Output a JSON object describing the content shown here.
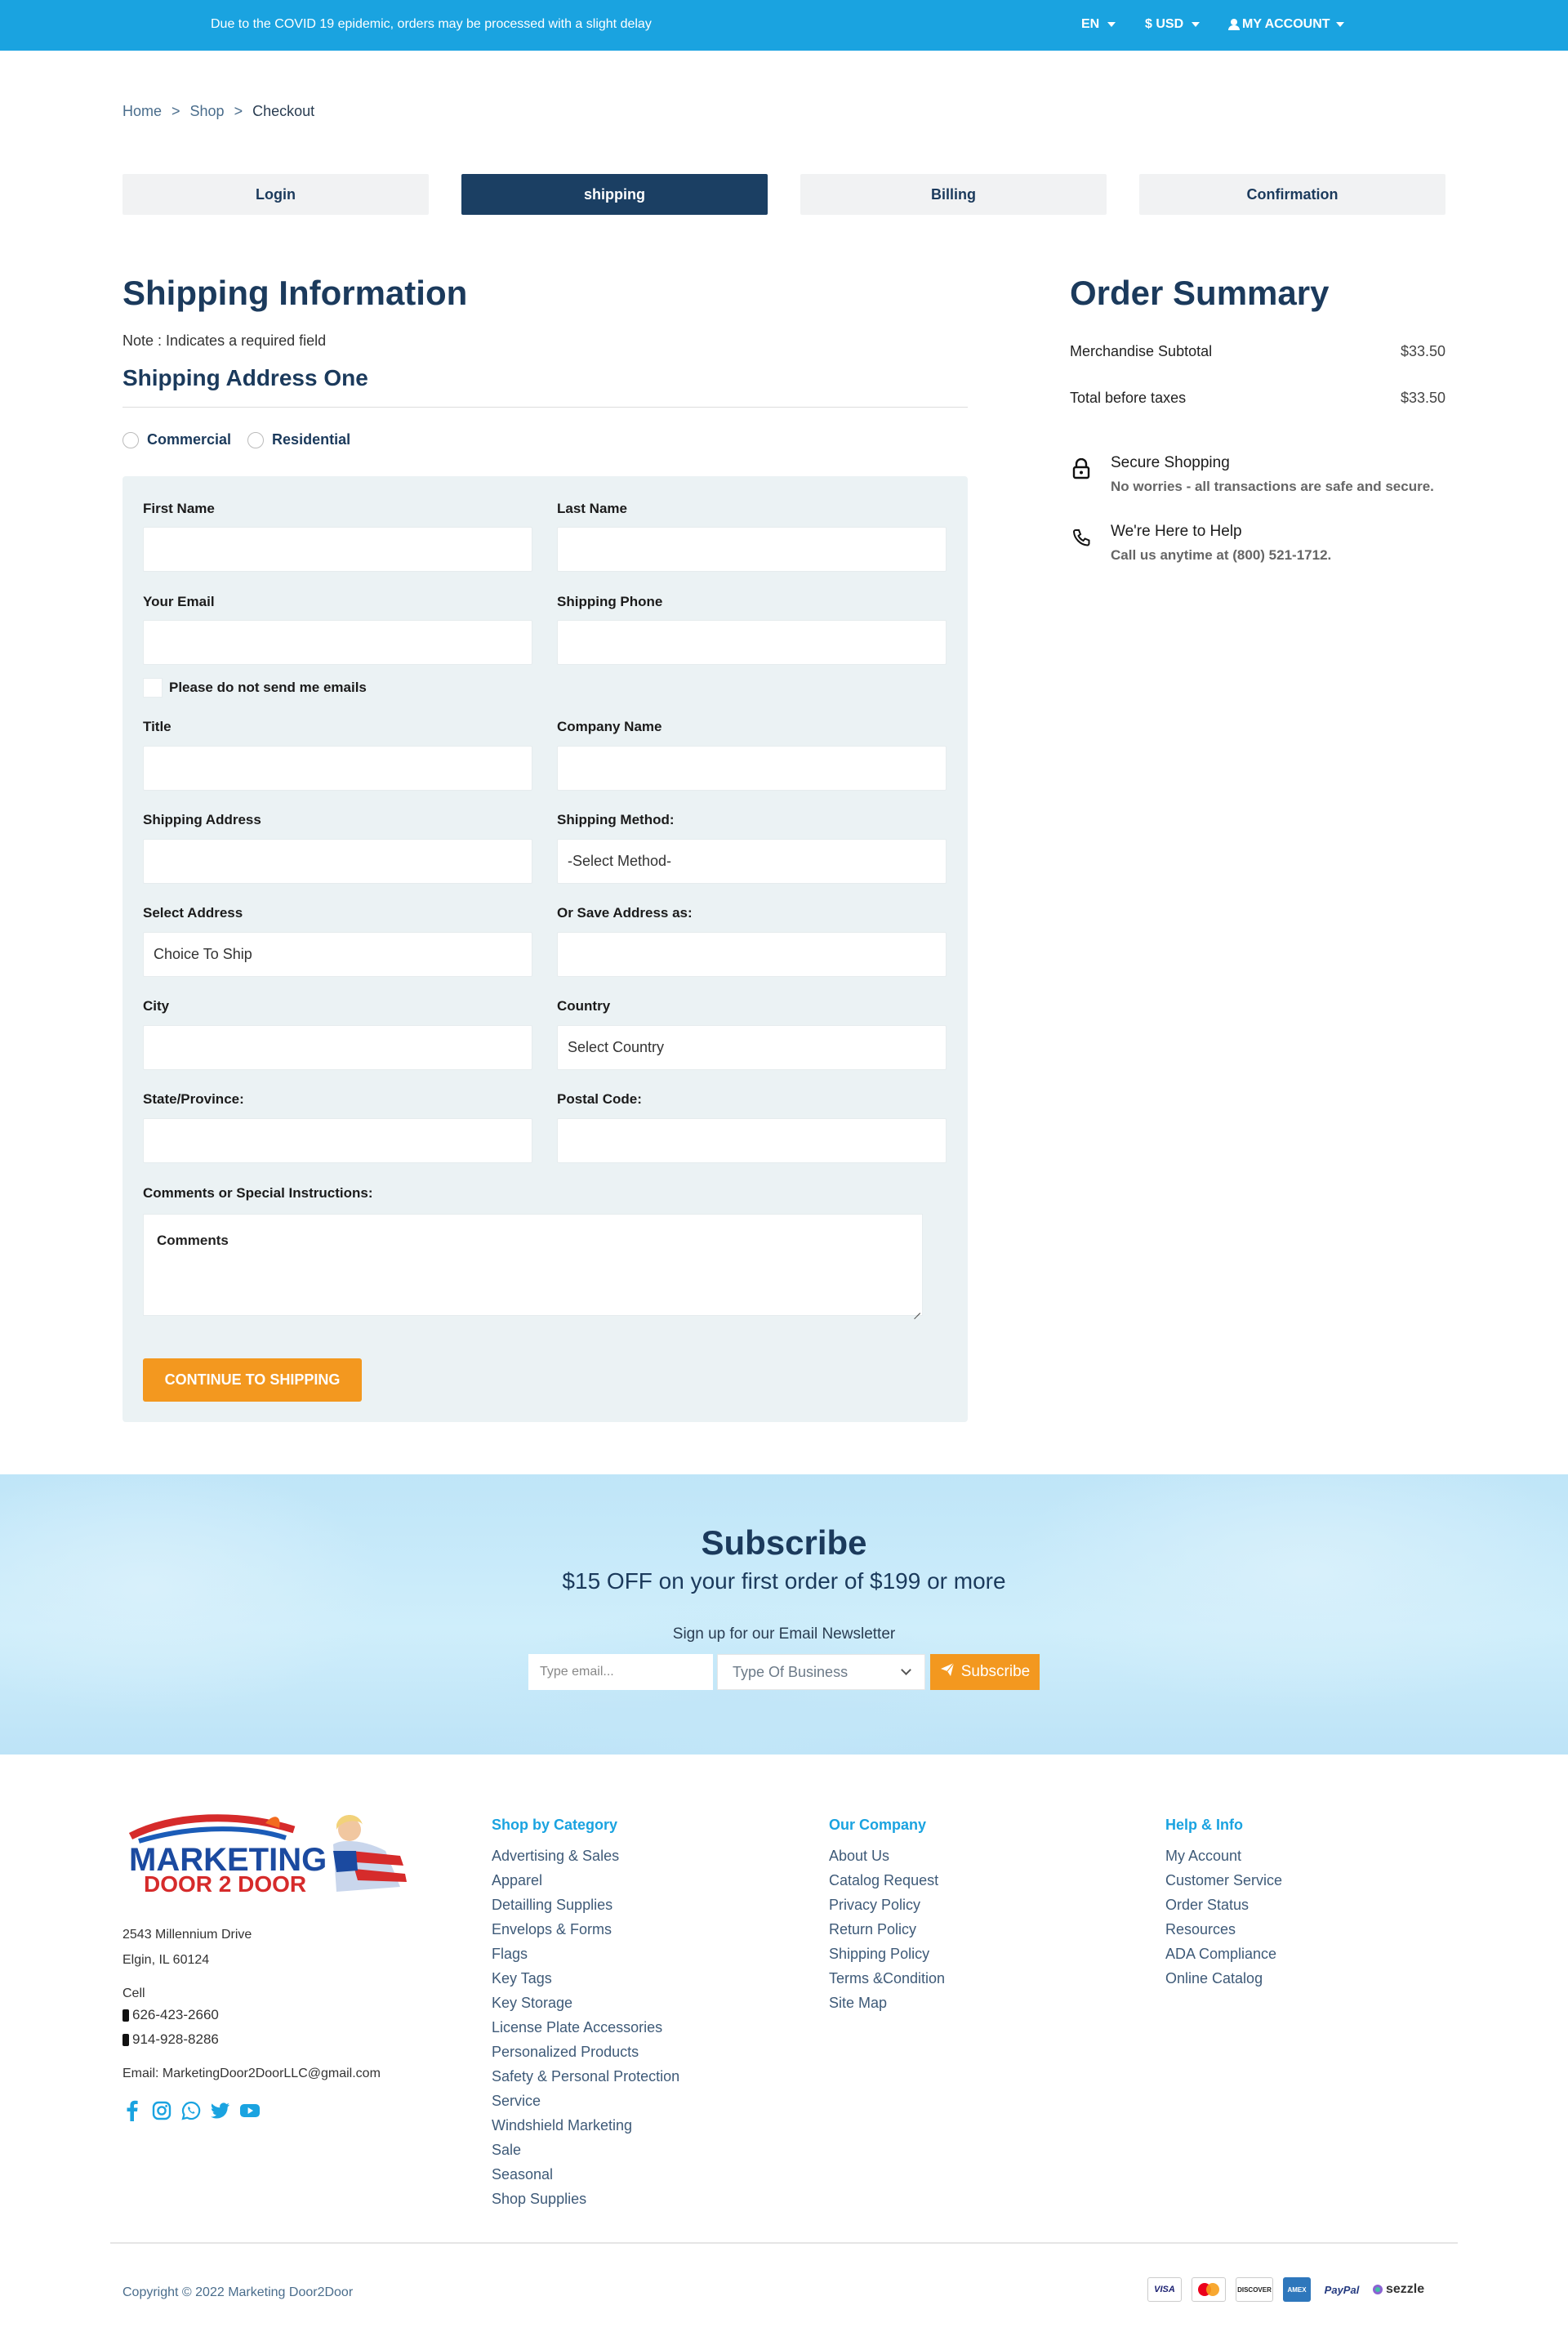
{
  "topbar": {
    "notice": "Due to the COVID 19 epidemic, orders may be processed with a slight delay",
    "language": "EN",
    "currency": "$ USD",
    "account": "MY ACCOUNT"
  },
  "breadcrumb": {
    "items": [
      "Home",
      "Shop",
      "Checkout"
    ],
    "separator": ">"
  },
  "steps": [
    {
      "label": "Login",
      "active": false
    },
    {
      "label": "shipping",
      "active": true
    },
    {
      "label": "Billing",
      "active": false
    },
    {
      "label": "Confirmation",
      "active": false
    }
  ],
  "shipping": {
    "title": "Shipping Information",
    "note": "Note :  Indicates a required field",
    "address_title": "Shipping Address One",
    "address_types": [
      "Commercial",
      "Residential"
    ],
    "fields": {
      "first_name": {
        "label": "First Name",
        "value": ""
      },
      "last_name": {
        "label": "Last Name",
        "value": ""
      },
      "email": {
        "label": "Your Email",
        "value": ""
      },
      "phone": {
        "label": "Shipping Phone",
        "value": ""
      },
      "no_email_label": "Please do not send me emails",
      "title": {
        "label": "Title",
        "value": ""
      },
      "company": {
        "label": "Company Name",
        "value": ""
      },
      "address": {
        "label": "Shipping Address",
        "value": ""
      },
      "method": {
        "label": "Shipping Method:",
        "value": "-Select Method-"
      },
      "select_address": {
        "label": "Select Address",
        "value": "Choice To Ship"
      },
      "save_as": {
        "label": "Or Save Address as:",
        "value": ""
      },
      "city": {
        "label": "City",
        "value": ""
      },
      "country": {
        "label": "Country",
        "value": "Select Country"
      },
      "state": {
        "label": "State/Province:",
        "value": ""
      },
      "postal": {
        "label": "Postal Code:",
        "value": ""
      },
      "comments": {
        "label": "Comments or Special Instructions:",
        "placeholder": "Comments"
      }
    },
    "continue_label": "CONTINUE TO SHIPPING"
  },
  "order_summary": {
    "title": "Order Summary",
    "rows": [
      {
        "label": "Merchandise Subtotal",
        "amount": "$33.50"
      },
      {
        "label": "Total before taxes",
        "amount": "$33.50"
      }
    ],
    "secure_title": "Secure Shopping",
    "secure_sub": "No worries - all transactions are safe and secure.",
    "help_title": "We're Here to Help",
    "help_sub": "Call us anytime at (800) 521-1712."
  },
  "subscribe": {
    "title": "Subscribe",
    "offer": "$15 OFF on your first order of $199 or more",
    "note": "Sign up for our Email Newsletter",
    "email_placeholder": "Type email...",
    "business_select": "Type Of Business",
    "button": "Subscribe"
  },
  "footer": {
    "logo_text_1": "MARKETING",
    "logo_text_2": "DOOR 2 DOOR",
    "address_1": "2543 Millennium Drive",
    "address_2": "Elgin, IL 60124",
    "cell_label": "Cell",
    "phone_1": "626-423-2660",
    "phone_2": "914-928-8286",
    "email": "Email: MarketingDoor2DoorLLC@gmail.com",
    "shop_head": "Shop by Category",
    "shop_links": [
      "Advertising & Sales",
      "Apparel",
      "Detailling Supplies",
      "Envelops & Forms",
      "Flags",
      "Key Tags",
      "Key Storage",
      "License Plate Accessories",
      "Personalized Products",
      "Safety & Personal Protection",
      "Service",
      "Windshield Marketing",
      "Sale",
      "Seasonal",
      "Shop Supplies"
    ],
    "company_head": "Our Company",
    "company_links": [
      "About Us",
      "Catalog Request",
      "Privacy Policy",
      "Return Policy",
      "Shipping Policy",
      "Terms &Condition",
      "Site Map"
    ],
    "help_head": "Help & Info",
    "help_links": [
      "My Account",
      "Customer Service",
      "Order Status",
      "Resources",
      "ADA Compliance",
      "Online Catalog"
    ],
    "copyright": "Copyright © 2022 Marketing Door2Door",
    "payments": [
      "VISA",
      "mastercard",
      "DISCOVER",
      "AMEX",
      "PayPal",
      "sezzle"
    ]
  },
  "colors": {
    "topbar": "#1aa3e0",
    "navy": "#1b3a5c",
    "active_step": "#1b3f63",
    "accent_orange": "#f3981f",
    "panel": "#ebf2f4"
  }
}
